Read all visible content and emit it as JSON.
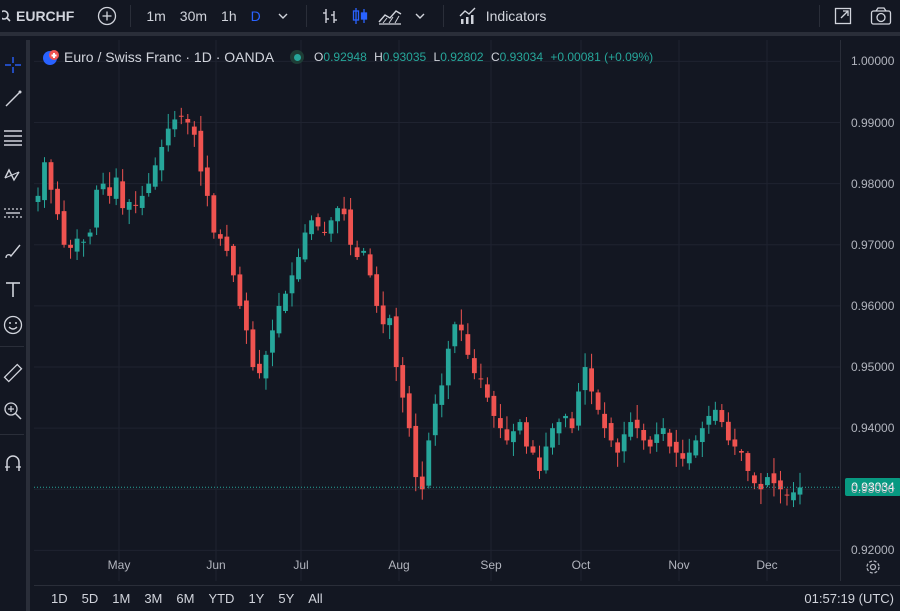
{
  "toolbar": {
    "symbol": "EURCHF",
    "intervals": [
      "1m",
      "30m",
      "1h",
      "D"
    ],
    "active_interval": "D",
    "indicators_label": "Indicators"
  },
  "legend": {
    "title": "Euro / Swiss Franc · 1D · OANDA",
    "open_label": "O",
    "open": "0.92948",
    "high_label": "H",
    "high": "0.93035",
    "low_label": "L",
    "low": "0.92802",
    "close_label": "C",
    "close": "0.93034",
    "change": "+0.00081 (+0.09%)"
  },
  "price_axis": {
    "labels": [
      "1.00000",
      "0.99000",
      "0.98000",
      "0.97000",
      "0.96000",
      "0.95000",
      "0.94000",
      "0.93000",
      "0.92000"
    ],
    "last_price": "0.93034"
  },
  "time_axis": {
    "labels": [
      "May",
      "Jun",
      "Jul",
      "Aug",
      "Sep",
      "Oct",
      "Nov",
      "Dec"
    ]
  },
  "bottom": {
    "ranges": [
      "1D",
      "5D",
      "1M",
      "3M",
      "6M",
      "YTD",
      "1Y",
      "5Y",
      "All"
    ],
    "clock": "01:57:19 (UTC)"
  },
  "colors": {
    "up": "#26a69a",
    "down": "#ef5350",
    "background": "#131722",
    "grid": "#1f2330"
  },
  "chart_data": {
    "type": "candlestick",
    "symbol": "EURCHF",
    "interval": "1D",
    "ylim": [
      0.915,
      1.0035
    ],
    "yticks": [
      1.0,
      0.99,
      0.98,
      0.97,
      0.96,
      0.95,
      0.94,
      0.93,
      0.92
    ],
    "x_months": [
      "May",
      "Jun",
      "Jul",
      "Aug",
      "Sep",
      "Oct",
      "Nov",
      "Dec"
    ],
    "last_close": 0.93034,
    "close_path": [
      0.978,
      0.9835,
      0.979,
      0.975,
      0.97,
      0.9695,
      0.971,
      0.9705,
      0.972,
      0.979,
      0.98,
      0.978,
      0.981,
      0.976,
      0.977,
      0.9765,
      0.978,
      0.98,
      0.983,
      0.986,
      0.989,
      0.9905,
      0.991,
      0.99,
      0.988,
      0.982,
      0.978,
      0.972,
      0.971,
      0.969,
      0.965,
      0.96,
      0.956,
      0.95,
      0.949,
      0.952,
      0.956,
      0.96,
      0.962,
      0.965,
      0.968,
      0.972,
      0.974,
      0.973,
      0.972,
      0.974,
      0.976,
      0.975,
      0.97,
      0.968,
      0.969,
      0.965,
      0.96,
      0.957,
      0.958,
      0.95,
      0.945,
      0.94,
      0.932,
      0.93,
      0.938,
      0.944,
      0.947,
      0.953,
      0.957,
      0.956,
      0.952,
      0.949,
      0.948,
      0.945,
      0.942,
      0.94,
      0.938,
      0.9395,
      0.941,
      0.937,
      0.936,
      0.933,
      0.937,
      0.94,
      0.941,
      0.942,
      0.94,
      0.946,
      0.95,
      0.946,
      0.943,
      0.94,
      0.938,
      0.936,
      0.939,
      0.941,
      0.94,
      0.938,
      0.937,
      0.939,
      0.94,
      0.937,
      0.936,
      0.935,
      0.936,
      0.938,
      0.94,
      0.942,
      0.943,
      0.941,
      0.938,
      0.937,
      0.936,
      0.933,
      0.931,
      0.93,
      0.932,
      0.931,
      0.93,
      0.929,
      0.9295,
      0.9303
    ]
  }
}
